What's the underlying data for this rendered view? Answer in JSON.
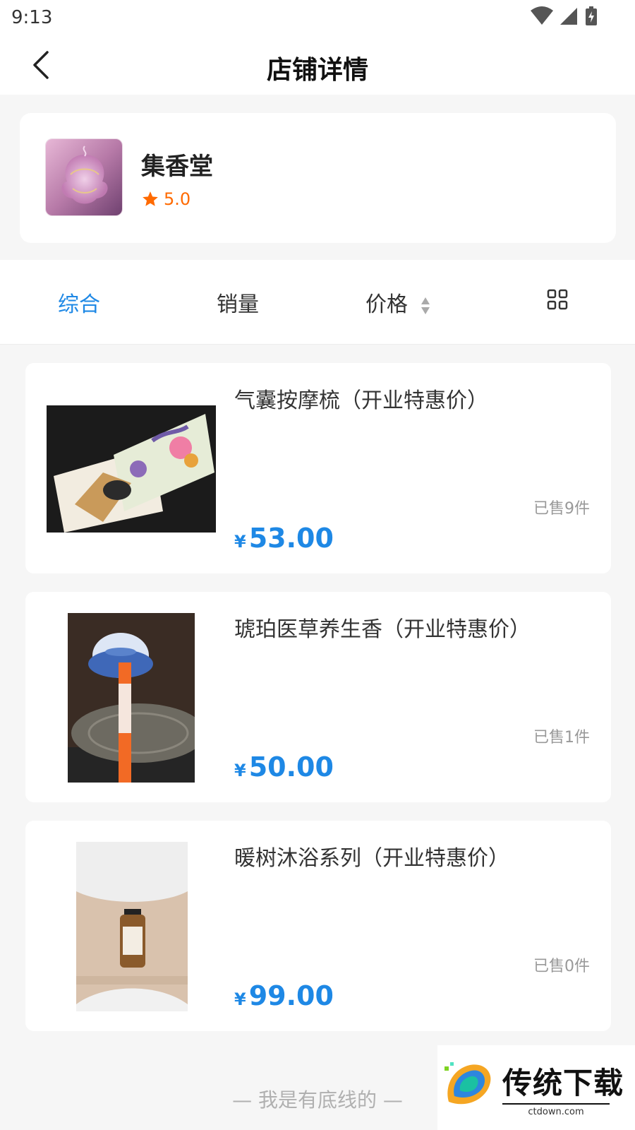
{
  "status": {
    "time": "9:13"
  },
  "nav": {
    "title": "店铺详情"
  },
  "shop": {
    "name": "集香堂",
    "rating": "5.0",
    "logo_text": "集香堂"
  },
  "sort": {
    "tabs": [
      "综合",
      "销量",
      "价格"
    ],
    "active_index": 0
  },
  "products": [
    {
      "title": "气囊按摩梳（开业特惠价）",
      "sold": "已售9件",
      "currency": "¥",
      "price": "53.00"
    },
    {
      "title": "琥珀医草养生香（开业特惠价）",
      "sold": "已售1件",
      "currency": "¥",
      "price": "50.00"
    },
    {
      "title": "暖树沐浴系列（开业特惠价）",
      "sold": "已售0件",
      "currency": "¥",
      "price": "99.00"
    }
  ],
  "footer": {
    "note": "— 我是有底线的 —"
  },
  "watermark": {
    "text": "传统下载",
    "url": "ctdown.com"
  },
  "colors": {
    "accent": "#1e88e5",
    "rating": "#ff6a00",
    "background": "#f6f6f6"
  }
}
